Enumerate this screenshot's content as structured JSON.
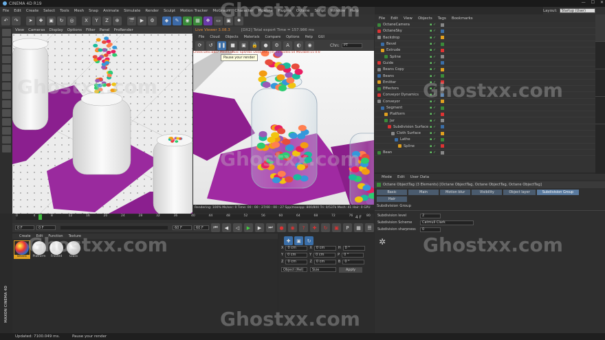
{
  "app": {
    "title": "CINEMA 4D R19"
  },
  "menu": [
    "File",
    "Edit",
    "Create",
    "Select",
    "Tools",
    "Mesh",
    "Snap",
    "Animate",
    "Simulate",
    "Render",
    "Sculpt",
    "Motion Tracker",
    "MoGraph",
    "Character",
    "Pipeline",
    "Plugins",
    "Octane",
    "Script",
    "Window",
    "Help"
  ],
  "viewport1": {
    "menu": [
      "View",
      "Cameras",
      "Display",
      "Options",
      "Filter",
      "Panel",
      "ProRender"
    ]
  },
  "viewport2": {
    "title": "Live Viewer 3.08.3",
    "info": "[DX2] Total export Time = 157.986 ms",
    "menu": [
      "File",
      "Cloud",
      "Objects",
      "Materials",
      "Compare",
      "Options",
      "Help",
      "GUI"
    ],
    "channel_label": "Chn:",
    "channel_value": "PT",
    "tooltip": "Pause your render",
    "status": "Rendering: 100% Ms/sec: 0  Time: 00 : 00 : 27/00 : 00 : 27  Spp/maxspp: 800/800  Tri: 0/537k  Mesh: 41  Hair: 0    GPU",
    "overlay": "Check:Dev.ia8s7 MeshCutExc Spd/dac Data[0/0.0]Tri:11 Nodes:50 Movable:15 0:0"
  },
  "timeline": {
    "ticks": [
      "0",
      "4",
      "8",
      "12",
      "16",
      "20",
      "24",
      "28",
      "32",
      "36",
      "40",
      "44",
      "48",
      "52",
      "56",
      "60",
      "64",
      "68",
      "72",
      "76",
      "80"
    ],
    "end_label": "4 F",
    "start_field": "0 F",
    "cur_field": "0 F",
    "end_field": "60 F",
    "end_field2": "60 F"
  },
  "material_manager": {
    "menu": [
      "Create",
      "Edit",
      "Function",
      "Texture"
    ],
    "materials": [
      "Beans",
      "Platform",
      "Frosted",
      "Glass"
    ]
  },
  "coordinates": {
    "rows": [
      {
        "a": "X",
        "av": "0 cm",
        "b": "X",
        "bv": "0 cm",
        "c": "H",
        "cv": "0 °"
      },
      {
        "a": "Y",
        "av": "0 cm",
        "b": "Y",
        "bv": "0 cm",
        "c": "P",
        "cv": "0 °"
      },
      {
        "a": "Z",
        "av": "0 cm",
        "b": "Z",
        "bv": "0 cm",
        "c": "B",
        "cv": "0 °"
      }
    ],
    "mode": "Object (Rel)",
    "size_mode": "Size",
    "apply": "Apply"
  },
  "object_manager": {
    "menu": [
      "File",
      "Edit",
      "View",
      "Objects",
      "Tags",
      "Bookmarks"
    ],
    "layout_label": "Layout:",
    "layout_value": "Startup (User)",
    "objects": [
      {
        "name": "OctaneCamera",
        "indent": 0
      },
      {
        "name": "OctaneSky",
        "indent": 0
      },
      {
        "name": "Backdrop",
        "indent": 0
      },
      {
        "name": "Bevel",
        "indent": 1
      },
      {
        "name": "Extrude",
        "indent": 1
      },
      {
        "name": "Spline",
        "indent": 2
      },
      {
        "name": "Guide",
        "indent": 0
      },
      {
        "name": "Beans Copy",
        "indent": 0
      },
      {
        "name": "Beans",
        "indent": 0
      },
      {
        "name": "Emitter",
        "indent": 0
      },
      {
        "name": "Effectors",
        "indent": 0
      },
      {
        "name": "Conveyor Dynamics",
        "indent": 0
      },
      {
        "name": "Conveyor",
        "indent": 0
      },
      {
        "name": "Segment",
        "indent": 1
      },
      {
        "name": "Platform",
        "indent": 2
      },
      {
        "name": "Jar",
        "indent": 2
      },
      {
        "name": "Subdivision Surface",
        "indent": 3
      },
      {
        "name": "Cloth Surface",
        "indent": 4
      },
      {
        "name": "Lathe",
        "indent": 5
      },
      {
        "name": "Spline",
        "indent": 6
      },
      {
        "name": "Bean",
        "indent": 0
      }
    ]
  },
  "attributes": {
    "menu": [
      "Mode",
      "Edit",
      "User Data"
    ],
    "header": "Octane ObjectTag (3 Elements) [Octane ObjectTag, Octane ObjectTag, Octane ObjectTag]",
    "tabs": [
      "Basic",
      "Main",
      "Motion blur",
      "Visibility",
      "Object layer",
      "Subdivision Group",
      "Hair"
    ],
    "section": "Subdivision Group",
    "fields": [
      {
        "label": "Subdivision level",
        "value": "2"
      },
      {
        "label": "Subdivision Scheme",
        "value": "Catmull Clark"
      },
      {
        "label": "Subdivision sharpness",
        "value": "0"
      }
    ]
  },
  "status_bar": {
    "left": "Updated: 7100.049 ms.",
    "right": "Pause your render"
  },
  "watermark": "Ghostxx.com",
  "brand": "MAXON CINEMA 4D"
}
